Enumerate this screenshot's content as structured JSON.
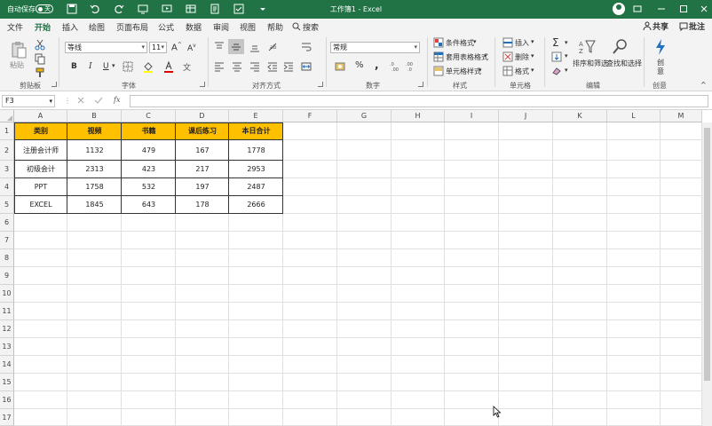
{
  "titlebar": {
    "autosave_label": "自动保存",
    "autosave_state": "关",
    "doc_title": "工作簿1 - Excel"
  },
  "menu": {
    "tabs": [
      "文件",
      "开始",
      "插入",
      "绘图",
      "页面布局",
      "公式",
      "数据",
      "审阅",
      "视图",
      "帮助"
    ],
    "active_tab": "开始",
    "search_label": "搜索",
    "share_label": "共享",
    "comment_label": "批注"
  },
  "ribbon": {
    "clipboard": {
      "paste": "粘贴",
      "group": "剪贴板"
    },
    "font": {
      "name": "等线",
      "size": "11",
      "group": "字体"
    },
    "alignment": {
      "group": "对齐方式"
    },
    "number": {
      "format": "常规",
      "group": "数字"
    },
    "styles": {
      "conditional": "条件格式",
      "table": "套用表格格式",
      "cell": "单元格样式",
      "group": "样式"
    },
    "cells": {
      "insert": "插入",
      "delete": "删除",
      "format": "格式",
      "group": "单元格"
    },
    "editing": {
      "sort": "排序和筛选",
      "find": "查找和选择",
      "group": "编辑"
    },
    "ideas": {
      "label": "创意",
      "group": "创意"
    }
  },
  "formula_bar": {
    "name_box": "F3",
    "fx": "fx",
    "value": ""
  },
  "sheet": {
    "columns": [
      "A",
      "B",
      "C",
      "D",
      "E",
      "F",
      "G",
      "H",
      "I",
      "J",
      "K",
      "L",
      "M"
    ],
    "rows": [
      "1",
      "2",
      "3",
      "4",
      "5",
      "6",
      "7",
      "8",
      "9",
      "10",
      "11",
      "12",
      "13",
      "14",
      "15",
      "16",
      "17"
    ],
    "table": {
      "header": [
        "类别",
        "视频",
        "书籍",
        "课后练习",
        "本日合计"
      ],
      "rows": [
        [
          "注册会计师",
          "1132",
          "479",
          "167",
          "1778"
        ],
        [
          "初级会计",
          "2313",
          "423",
          "217",
          "2953"
        ],
        [
          "PPT",
          "1758",
          "532",
          "197",
          "2487"
        ],
        [
          "EXCEL",
          "1845",
          "643",
          "178",
          "2666"
        ]
      ]
    },
    "header_fill": "#ffc000",
    "accent": "#217346"
  }
}
